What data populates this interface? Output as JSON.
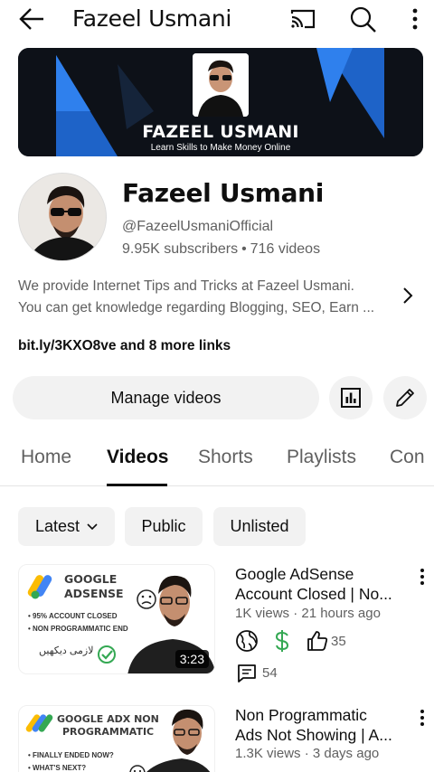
{
  "header": {
    "title": "Fazeel Usmani",
    "back_icon": "arrow-left-icon",
    "cast_icon": "cast-icon",
    "search_icon": "search-icon",
    "more_icon": "more-vert-icon"
  },
  "banner": {
    "title": "FAZEEL USMANI",
    "tagline": "Learn Skills to Make Money Online",
    "colors": {
      "background": "#0d1118",
      "accent": "#1e63c8"
    }
  },
  "channel": {
    "name": "Fazeel Usmani",
    "handle": "@FazeelUsmaniOfficial",
    "subscribers": "9.95K subscribers",
    "separator": "•",
    "videos": "716 videos",
    "description_line1": "We provide Internet Tips and Tricks at Fazeel Usmani.",
    "description_line2": "You can get knowledge regarding Blogging, SEO, Earn ...",
    "links": "bit.ly/3KXO8ve and 8 more links"
  },
  "actions": {
    "manage_label": "Manage videos",
    "analytics_icon": "analytics-icon",
    "edit_icon": "pencil-icon"
  },
  "tabs": [
    {
      "label": "Home"
    },
    {
      "label": "Videos",
      "active": true
    },
    {
      "label": "Shorts"
    },
    {
      "label": "Playlists"
    },
    {
      "label": "Con"
    }
  ],
  "filters": {
    "latest": "Latest",
    "public": "Public",
    "unlisted": "Unlisted"
  },
  "videos": [
    {
      "thumb_line1": "GOOGLE",
      "thumb_line2": "ADSENSE",
      "thumb_bullet1": "• 95% ACCOUNT CLOSED",
      "thumb_bullet2": "• NON PROGRAMMATIC END",
      "thumb_urdu": "لازمی دیکھیں",
      "duration": "3:23",
      "title_line1": "Google AdSense",
      "title_line2": "Account Closed | No...",
      "meta": "1K views · 21 hours ago",
      "likes": "35",
      "comments": "54"
    },
    {
      "thumb_line1": "GOOGLE ADX NON",
      "thumb_line2": "PROGRAMMATIC",
      "thumb_bullet1": "• FINALLY ENDED NOW?",
      "thumb_bullet2": "• WHAT'S NEXT?",
      "title_line1": "Non Programmatic",
      "title_line2": "Ads Not Showing | A...",
      "meta": "1.3K views · 3 days ago"
    }
  ]
}
